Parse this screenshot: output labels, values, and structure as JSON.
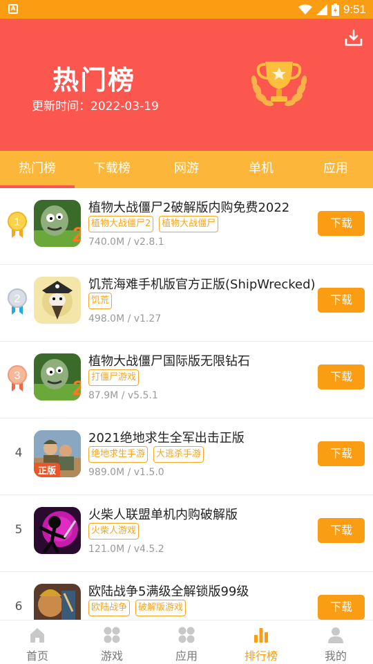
{
  "status_bar": {
    "time": "9:51",
    "left_icon": "A"
  },
  "header": {
    "title": "热门榜",
    "update_label": "更新时间：",
    "update_date": "2022-03-19",
    "download_icon": "download-icon",
    "trophy_icon": "trophy-icon"
  },
  "tabs": [
    {
      "label": "热门榜",
      "active": true
    },
    {
      "label": "下载榜",
      "active": false
    },
    {
      "label": "网游",
      "active": false
    },
    {
      "label": "单机",
      "active": false
    },
    {
      "label": "应用",
      "active": false
    }
  ],
  "apps": [
    {
      "rank": "1",
      "name": "植物大战僵尸2破解版内购免费2022",
      "tags": [
        "植物大战僵尸2",
        "植物大战僵尸"
      ],
      "meta": "740.0M / v2.8.1",
      "button": "下载"
    },
    {
      "rank": "2",
      "name": "饥荒海难手机版官方正版(ShipWrecked)",
      "tags": [
        "饥荒"
      ],
      "meta": "498.0M / v1.27",
      "button": "下载"
    },
    {
      "rank": "3",
      "name": "植物大战僵尸国际版无限钻石",
      "tags": [
        "打僵尸游戏"
      ],
      "meta": "87.9M / v5.5.1",
      "button": "下载"
    },
    {
      "rank": "4",
      "name": "2021绝地求生全军出击正版",
      "tags": [
        "绝地求生手游",
        "大逃杀手游"
      ],
      "meta": "989.0M / v1.5.0",
      "button": "下载",
      "badge": "正版"
    },
    {
      "rank": "5",
      "name": "火柴人联盟单机内购破解版",
      "tags": [
        "火柴人游戏"
      ],
      "meta": "121.0M / v4.5.2",
      "button": "下载"
    },
    {
      "rank": "6",
      "name": "欧陆战争5满级全解锁版99级",
      "tags": [
        "欧陆战争",
        "破解版游戏"
      ],
      "meta": "",
      "button": "下载"
    }
  ],
  "bottom_nav": [
    {
      "label": "首页",
      "icon": "home-icon",
      "active": false
    },
    {
      "label": "游戏",
      "icon": "games-grid-icon",
      "active": false
    },
    {
      "label": "应用",
      "icon": "apps-grid-icon",
      "active": false
    },
    {
      "label": "排行榜",
      "icon": "ranking-bars-icon",
      "active": true
    },
    {
      "label": "我的",
      "icon": "user-icon",
      "active": false
    }
  ],
  "colors": {
    "accent": "#fa9d13",
    "header_bg": "#fb574f",
    "tabs_bg": "#fcb73a"
  }
}
